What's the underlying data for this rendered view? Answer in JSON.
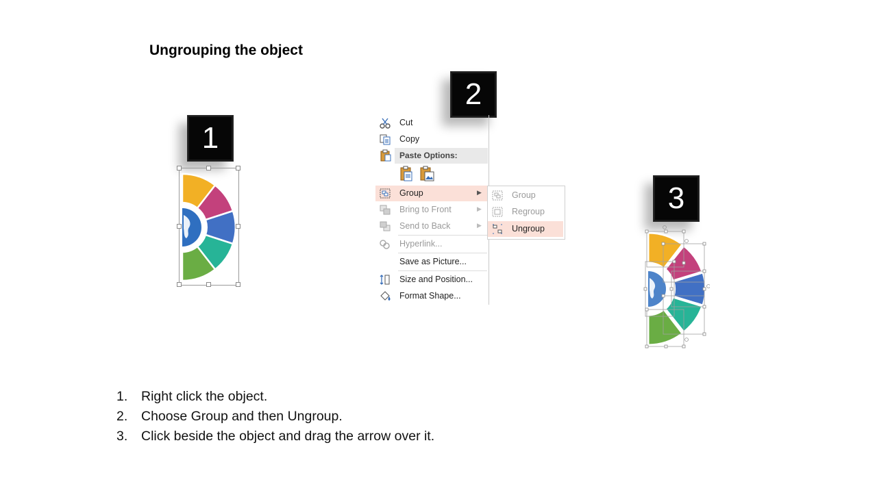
{
  "title": "Ungrouping the object",
  "badges": [
    "1",
    "2",
    "3"
  ],
  "context_menu": {
    "items": [
      {
        "label": "Cut",
        "icon": "scissors-icon",
        "disabled": false
      },
      {
        "label": "Copy",
        "icon": "copy-icon",
        "disabled": false
      },
      {
        "label": "Paste Options:",
        "icon": "clipboard-icon",
        "header": true
      },
      {
        "label": "Group",
        "icon": "group-icon",
        "highlighted": true,
        "submenu": true
      },
      {
        "label": "Bring to Front",
        "icon": "bring-front-icon",
        "disabled": true,
        "submenu": true
      },
      {
        "label": "Send to Back",
        "icon": "send-back-icon",
        "disabled": true,
        "submenu": true
      },
      {
        "label": "Hyperlink...",
        "icon": "link-icon",
        "disabled": true
      },
      {
        "label": "Save as Picture...",
        "disabled": false
      },
      {
        "label": "Size and Position...",
        "icon": "size-position-icon",
        "disabled": false
      },
      {
        "label": "Format Shape...",
        "icon": "paint-bucket-icon",
        "disabled": false
      }
    ],
    "submenu": [
      {
        "label": "Group",
        "icon": "group-icon",
        "disabled": true
      },
      {
        "label": "Regroup",
        "icon": "regroup-icon",
        "disabled": true
      },
      {
        "label": "Ungroup",
        "icon": "ungroup-icon",
        "highlighted": true
      }
    ]
  },
  "segment_colors": [
    "#f2b025",
    "#c3417c",
    "#4170c4",
    "#27b497",
    "#6aad44"
  ],
  "steps": [
    {
      "num": "1.",
      "text": "Right click the object."
    },
    {
      "num": "2.",
      "text": "Choose Group and then Ungroup."
    },
    {
      "num": "3.",
      "text": "Click beside the object and drag the arrow over it."
    }
  ]
}
